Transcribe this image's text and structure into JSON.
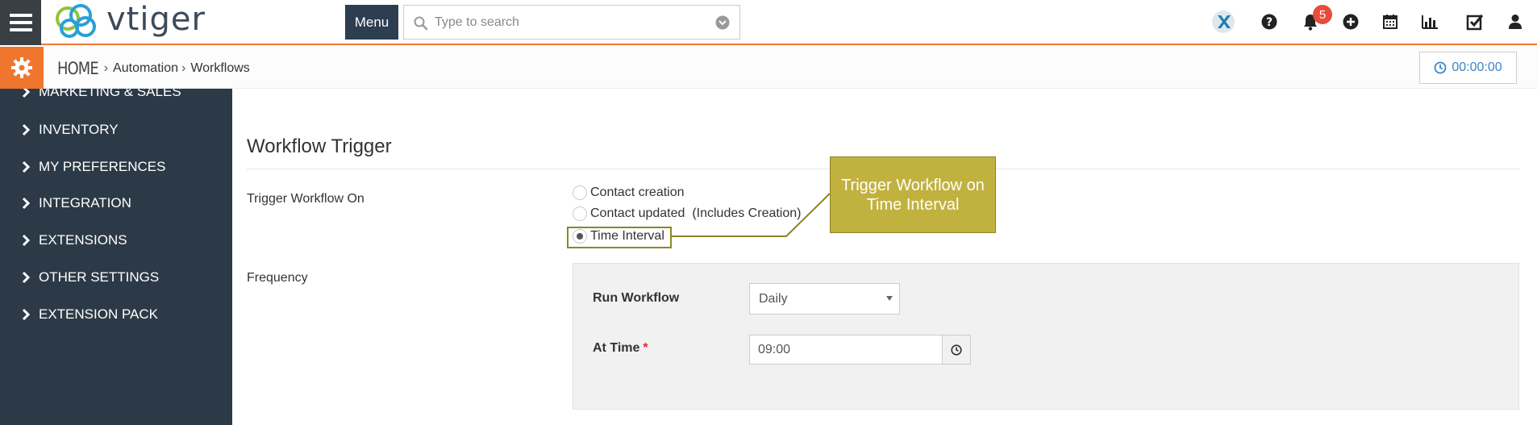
{
  "header": {
    "logo_text": "vtiger",
    "menu_label": "Menu",
    "search_placeholder": "Type to search",
    "notification_count": "5"
  },
  "settings_bar": {
    "breadcrumb": [
      "HOME",
      "Automation",
      "Workflows"
    ],
    "timer": "00:00:00"
  },
  "sidebar": {
    "items": [
      {
        "label": "MARKETING & SALES"
      },
      {
        "label": "INVENTORY"
      },
      {
        "label": "MY PREFERENCES"
      },
      {
        "label": "INTEGRATION"
      },
      {
        "label": "EXTENSIONS"
      },
      {
        "label": "OTHER SETTINGS"
      },
      {
        "label": "EXTENSION PACK"
      }
    ]
  },
  "workflow_trigger": {
    "title": "Workflow Trigger",
    "trigger_label": "Trigger Workflow On",
    "options": [
      {
        "label": "Contact creation",
        "checked": false
      },
      {
        "label": "Contact updated  (Includes Creation)",
        "checked": false
      },
      {
        "label": "Time Interval",
        "checked": true
      }
    ],
    "callout_line1": "Trigger Workflow on",
    "callout_line2": "Time Interval"
  },
  "frequency": {
    "label": "Frequency",
    "run_workflow_label": "Run Workflow",
    "run_workflow_value": "Daily",
    "at_time_label": "At Time",
    "required_mark": "*",
    "at_time_value": "09:00"
  },
  "colors": {
    "accent_orange": "#f0762e",
    "sidebar_bg": "#2c3a47",
    "menu_bg": "#2c3e50",
    "callout_bg": "#c1b13e",
    "timer_blue": "#3a86c8",
    "badge_red": "#e74c3c"
  },
  "icons": {
    "hamburger": "hamburger-icon",
    "search": "search-icon",
    "dropdown": "chevron-down-circle-icon",
    "gear": "gear-icon",
    "clock": "clock-icon",
    "top": [
      "x-app-icon",
      "help-icon",
      "bell-icon",
      "plus-circle-icon",
      "calendar-icon",
      "bar-chart-icon",
      "checkbox-icon",
      "user-icon"
    ]
  }
}
